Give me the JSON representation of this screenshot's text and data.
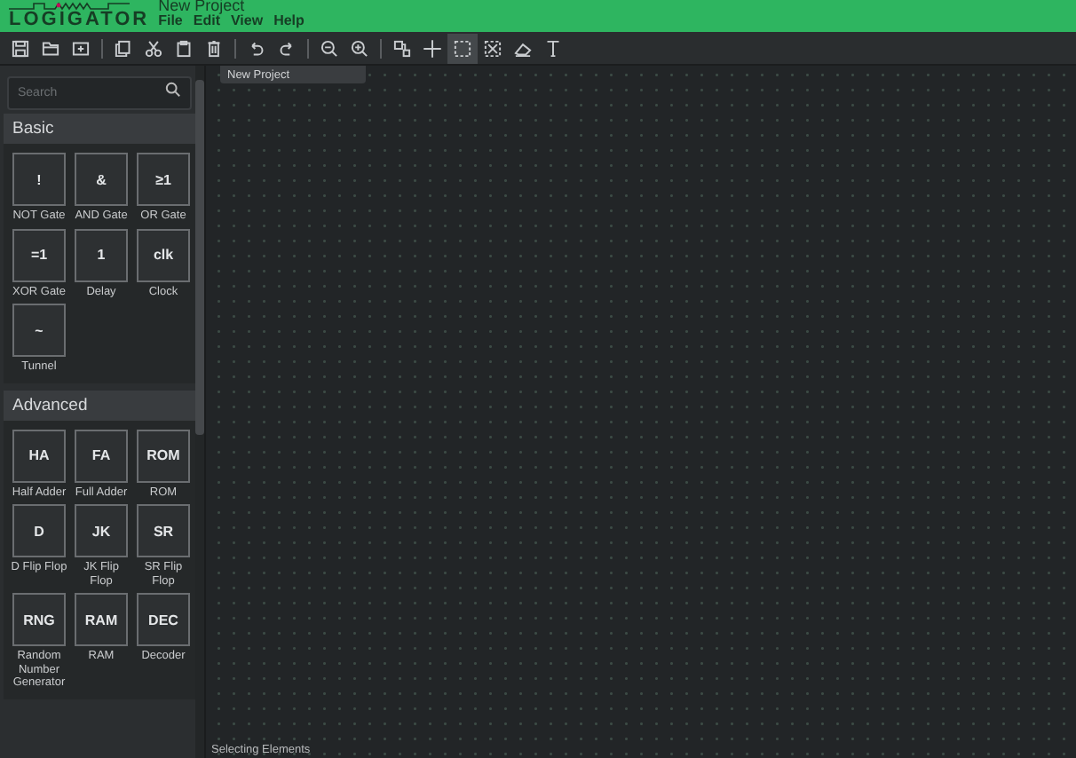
{
  "header": {
    "logo": "LOGIGATOR",
    "title": "New Project",
    "menu": [
      "File",
      "Edit",
      "View",
      "Help"
    ]
  },
  "toolbar": [
    [
      {
        "kind": "save",
        "selected": false
      },
      {
        "kind": "open",
        "selected": false
      },
      {
        "kind": "import",
        "selected": false
      }
    ],
    [
      {
        "kind": "copy",
        "selected": false
      },
      {
        "kind": "cut",
        "selected": false
      },
      {
        "kind": "paste",
        "selected": false
      },
      {
        "kind": "delete",
        "selected": false
      }
    ],
    [
      {
        "kind": "undo",
        "selected": false
      },
      {
        "kind": "redo",
        "selected": false
      }
    ],
    [
      {
        "kind": "zoom",
        "selected": false
      },
      {
        "kind": "zoom",
        "selected": false
      }
    ],
    [
      {
        "kind": "component",
        "selected": false
      },
      {
        "kind": "wire",
        "selected": false
      },
      {
        "kind": "select",
        "selected": true
      },
      {
        "kind": "cut-select",
        "selected": false
      },
      {
        "kind": "eraser",
        "selected": false
      },
      {
        "kind": "text",
        "selected": false
      }
    ]
  ],
  "sidebar": {
    "search": {
      "placeholder": "Search"
    },
    "sections": [
      {
        "title": "Basic",
        "items": [
          {
            "symbol": "!",
            "label": "NOT Gate"
          },
          {
            "symbol": "&",
            "label": "AND Gate"
          },
          {
            "symbol": "≥1",
            "label": "OR Gate"
          },
          {
            "symbol": "=1",
            "label": "XOR Gate"
          },
          {
            "symbol": "1",
            "label": "Delay"
          },
          {
            "symbol": "clk",
            "label": "Clock"
          },
          {
            "symbol": "~",
            "label": "Tunnel"
          }
        ]
      },
      {
        "title": "Advanced",
        "items": [
          {
            "symbol": "HA",
            "label": "Half Adder"
          },
          {
            "symbol": "FA",
            "label": "Full Adder"
          },
          {
            "symbol": "ROM",
            "label": "ROM"
          },
          {
            "symbol": "D",
            "label": "D Flip Flop"
          },
          {
            "symbol": "JK",
            "label": "JK Flip Flop"
          },
          {
            "symbol": "SR",
            "label": "SR Flip Flop"
          },
          {
            "symbol": "RNG",
            "label": "Random Number Generator"
          },
          {
            "symbol": "RAM",
            "label": "RAM"
          },
          {
            "symbol": "DEC",
            "label": "Decoder"
          }
        ]
      }
    ]
  },
  "workspace": {
    "tab": "New Project",
    "status": "Selecting Elements"
  }
}
